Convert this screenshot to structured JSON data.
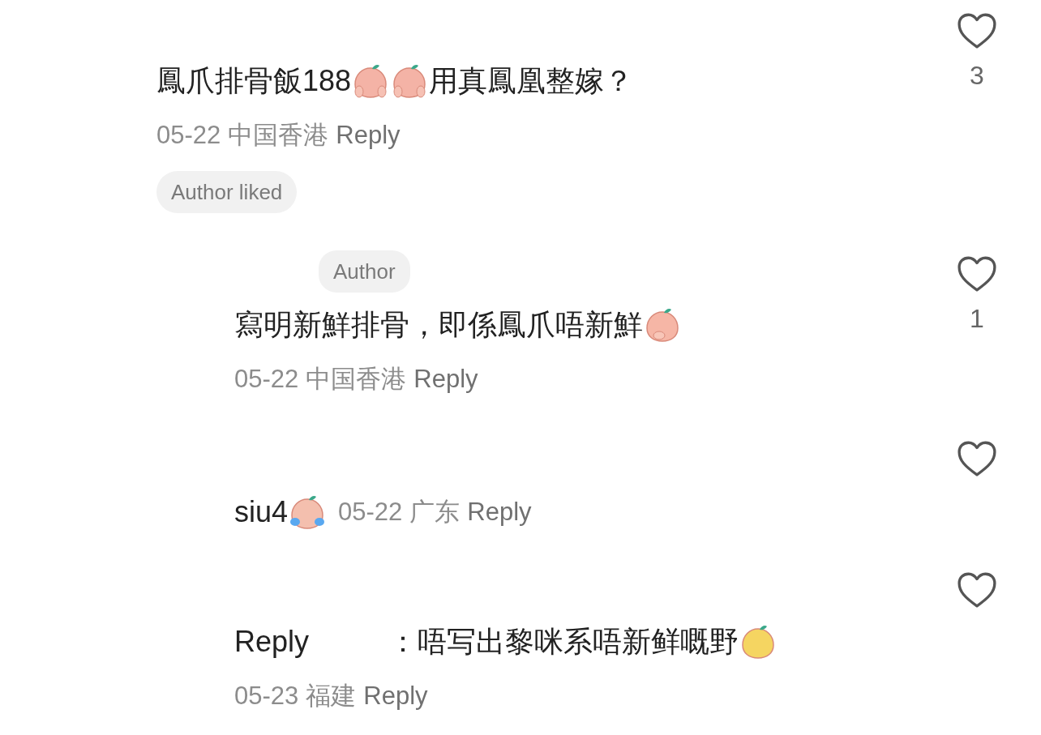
{
  "comments": [
    {
      "kind": "stacked",
      "segments": [
        {
          "kind": "text",
          "text": "鳳爪排骨飯188"
        },
        {
          "kind": "scream"
        },
        {
          "kind": "scream"
        },
        {
          "kind": "text",
          "text": "用真鳳凰整嫁？"
        }
      ],
      "meta": {
        "date": "05-22",
        "location": "中国香港",
        "reply": "Reply"
      },
      "badge": "Author liked",
      "likes": "3"
    },
    {
      "kind": "stacked",
      "tag": "Author",
      "segments": [
        {
          "kind": "text",
          "text": "寫明新鮮排骨，即係鳳爪唔新鮮"
        },
        {
          "kind": "giggle"
        }
      ],
      "meta": {
        "date": "05-22",
        "location": "中国香港",
        "reply": "Reply"
      },
      "likes": "1"
    },
    {
      "kind": "inline",
      "segments": [
        {
          "kind": "text",
          "text": "siu4"
        },
        {
          "kind": "laugh"
        }
      ],
      "meta": {
        "date": "05-22",
        "location": "广东",
        "reply": "Reply"
      }
    },
    {
      "kind": "stacked",
      "segments": [
        {
          "kind": "text",
          "text": "Reply"
        },
        {
          "kind": "blank"
        },
        {
          "kind": "text",
          "text": "：唔写出黎咪系唔新鲜嘅野"
        },
        {
          "kind": "grin"
        }
      ],
      "meta": {
        "date": "05-23",
        "location": "福建",
        "reply": "Reply"
      }
    }
  ]
}
